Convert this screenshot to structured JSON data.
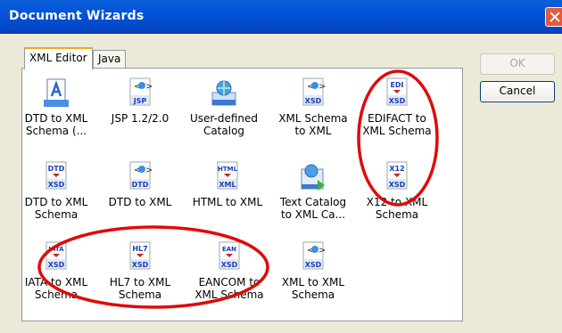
{
  "window": {
    "title": "Document Wizards"
  },
  "tabs": [
    {
      "label": "XML Editor",
      "active": true
    },
    {
      "label": "Java",
      "active": false
    }
  ],
  "buttons": {
    "ok": "OK",
    "cancel": "Cancel"
  },
  "items": [
    {
      "label": "DTD to XML\nSchema (...",
      "icon": "document-blue-a-icon"
    },
    {
      "label": "JSP 1.2/2.0",
      "icon": "jsp-icon",
      "badge": "JSP"
    },
    {
      "label": "User-defined\nCatalog",
      "icon": "catalog-globe-icon"
    },
    {
      "label": "XML Schema\nto XML",
      "icon": "xsd-icon",
      "badge": "XSD"
    },
    {
      "label": "EDIFACT to\nXML Schema",
      "icon": "edi-xsd-icon",
      "badge_top": "EDI",
      "badge": "XSD"
    },
    {
      "label": "DTD to XML\nSchema",
      "icon": "dtd-xsd-icon",
      "badge_top": "DTD",
      "badge": "XSD"
    },
    {
      "label": "DTD to XML",
      "icon": "dtd-icon",
      "badge": "DTD"
    },
    {
      "label": "HTML to XML",
      "icon": "html-xml-icon",
      "badge_top": "HTML",
      "badge": "XML"
    },
    {
      "label": "Text Catalog\nto XML Ca...",
      "icon": "text-catalog-icon"
    },
    {
      "label": "X12 to XML\nSchema",
      "icon": "x12-xsd-icon",
      "badge_top": "X12",
      "badge": "XSD"
    },
    {
      "label": "IATA to XML\nSchema",
      "icon": "iata-xsd-icon",
      "badge_top": "IATA",
      "badge": "XSD"
    },
    {
      "label": "HL7 to XML\nSchema",
      "icon": "hl7-xsd-icon",
      "badge_top": "HL7",
      "badge": "XSD"
    },
    {
      "label": "EANCOM to\nXML Schema",
      "icon": "ean-xsd-icon",
      "badge_top": "EAN",
      "badge": "XSD"
    },
    {
      "label": "XML to XML\nSchema",
      "icon": "xml-xsd-icon",
      "badge": "XSD"
    }
  ]
}
